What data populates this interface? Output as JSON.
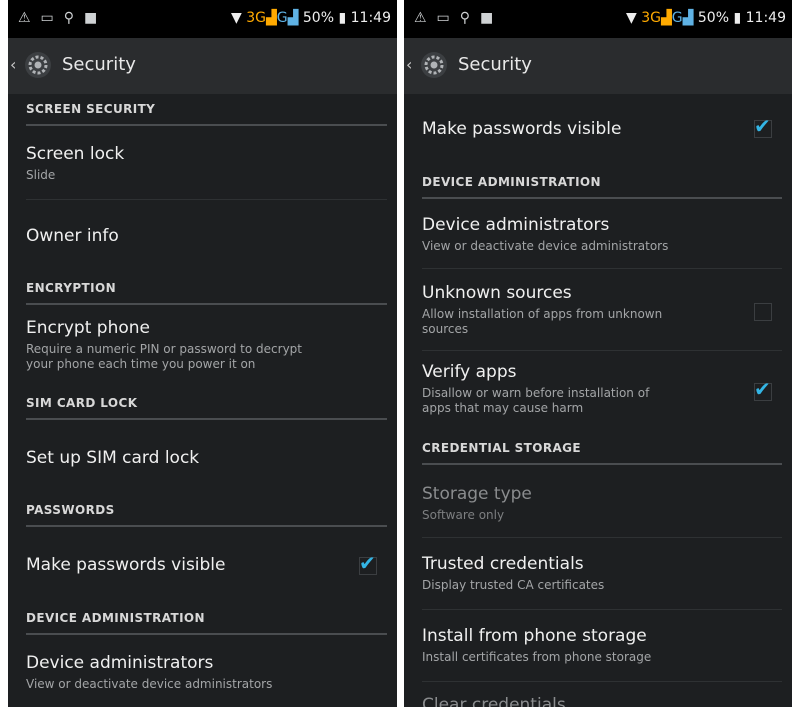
{
  "status": {
    "time": "11:49",
    "battery": "50%",
    "network": "3G",
    "network_g": "G"
  },
  "left": {
    "title": "Security",
    "sections": {
      "screen_security": "SCREEN SECURITY",
      "encryption": "ENCRYPTION",
      "sim_lock": "SIM CARD LOCK",
      "passwords": "PASSWORDS",
      "device_admin": "DEVICE ADMINISTRATION"
    },
    "items": {
      "screen_lock": {
        "title": "Screen lock",
        "summary": "Slide"
      },
      "owner_info": {
        "title": "Owner info"
      },
      "encrypt_phone": {
        "title": "Encrypt phone",
        "summary_line1": "Require a numeric PIN or password to decrypt",
        "summary_line2": "your phone each time you power it on"
      },
      "sim_lock": {
        "title": "Set up SIM card lock"
      },
      "passwords_visible": {
        "title": "Make passwords visible",
        "checked": true
      },
      "device_admins": {
        "title": "Device administrators",
        "summary": "View or deactivate device administrators"
      }
    }
  },
  "right": {
    "title": "Security",
    "sections": {
      "device_admin": "DEVICE ADMINISTRATION",
      "credential_storage": "CREDENTIAL STORAGE"
    },
    "items": {
      "passwords_visible": {
        "title": "Make passwords visible",
        "checked": true
      },
      "device_admins": {
        "title": "Device administrators",
        "summary": "View or deactivate device administrators"
      },
      "unknown_sources": {
        "title": "Unknown sources",
        "summary_line1": "Allow installation of apps from unknown",
        "summary_line2": "sources",
        "checked": false
      },
      "verify_apps": {
        "title": "Verify apps",
        "summary_line1": "Disallow or warn before installation of",
        "summary_line2": "apps that may cause harm",
        "checked": true
      },
      "storage_type": {
        "title": "Storage type",
        "summary": "Software only"
      },
      "trusted_credentials": {
        "title": "Trusted credentials",
        "summary": "Display trusted CA certificates"
      },
      "install_storage": {
        "title": "Install from phone storage",
        "summary": "Install certificates from phone storage"
      },
      "clear_credentials": {
        "title": "Clear credentials"
      }
    }
  },
  "colors": {
    "accent": "#33b5e5",
    "background": "#1d1f21",
    "actionbar": "#2a2c2e"
  }
}
